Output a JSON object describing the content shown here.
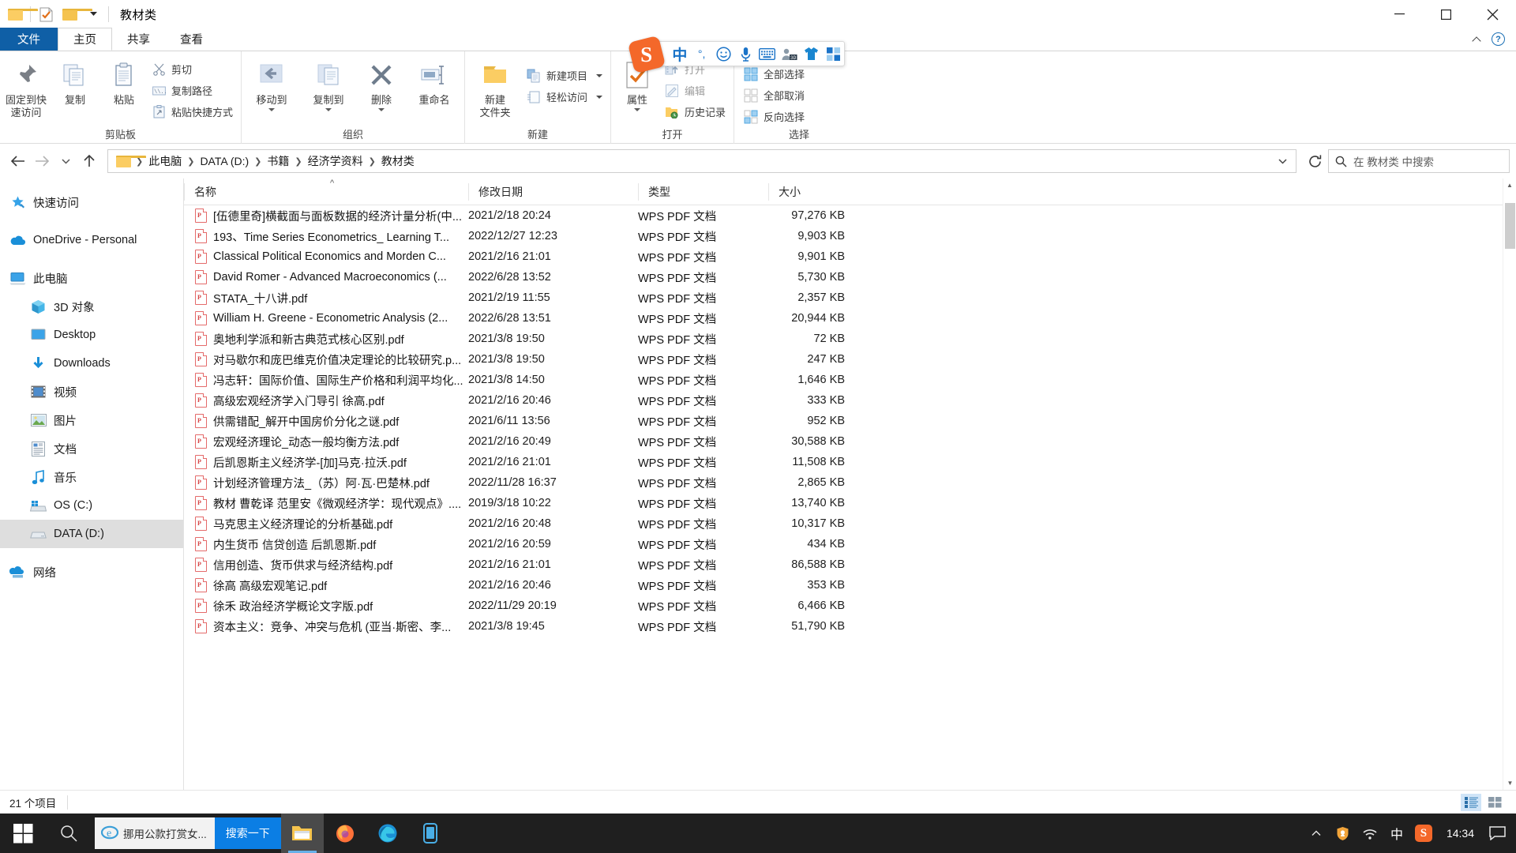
{
  "window": {
    "title": "教材类",
    "quick_access_icons": [
      "folder-icon",
      "properties-check-icon",
      "new-folder-icon",
      "chevron-down-icon"
    ],
    "controls": {
      "minimize": "minimize-icon",
      "maximize": "maximize-icon",
      "close": "close-icon"
    }
  },
  "tabs": [
    {
      "label": "文件",
      "kind": "file"
    },
    {
      "label": "主页",
      "kind": "active"
    },
    {
      "label": "共享",
      "kind": "normal"
    },
    {
      "label": "查看",
      "kind": "normal"
    }
  ],
  "ribbon": {
    "groups": [
      {
        "label": "剪贴板",
        "big": [
          {
            "label": "固定到快\n速访问",
            "icon": "pin-icon"
          },
          {
            "label": "复制",
            "icon": "copy-icon"
          },
          {
            "label": "粘贴",
            "icon": "paste-icon"
          }
        ],
        "small": [
          {
            "label": "剪切",
            "icon": "scissors-icon"
          },
          {
            "label": "复制路径",
            "icon": "copy-path-icon"
          },
          {
            "label": "粘贴快捷方式",
            "icon": "paste-shortcut-icon"
          }
        ]
      },
      {
        "label": "组织",
        "big": [
          {
            "label": "移动到",
            "icon": "move-to-icon",
            "has_caret": true
          },
          {
            "label": "复制到",
            "icon": "copy-to-icon",
            "has_caret": true
          },
          {
            "label": "删除",
            "icon": "delete-x-icon",
            "has_caret": true
          },
          {
            "label": "重命名",
            "icon": "rename-icon"
          }
        ],
        "small": []
      },
      {
        "label": "新建",
        "big": [
          {
            "label": "新建\n文件夹",
            "icon": "new-folder-icon"
          }
        ],
        "small": [
          {
            "label": "新建项目",
            "icon": "new-item-icon",
            "has_caret": true
          },
          {
            "label": "轻松访问",
            "icon": "easy-access-icon",
            "has_caret": true
          }
        ]
      },
      {
        "label": "打开",
        "big": [
          {
            "label": "属性",
            "icon": "properties-check-icon",
            "has_caret": true
          }
        ],
        "small": [
          {
            "label": "打开",
            "icon": "open-icon",
            "disabled": true
          },
          {
            "label": "编辑",
            "icon": "edit-pencil-icon",
            "disabled": true
          },
          {
            "label": "历史记录",
            "icon": "history-folder-icon"
          }
        ]
      },
      {
        "label": "选择",
        "big": [],
        "small": [
          {
            "label": "全部选择",
            "icon": "select-all-icon"
          },
          {
            "label": "全部取消",
            "icon": "select-none-icon"
          },
          {
            "label": "反向选择",
            "icon": "invert-selection-icon"
          }
        ]
      }
    ],
    "collapse_icon": "chevron-up-icon",
    "help_icon": "help-question-icon"
  },
  "ime_toolbar": {
    "logo_letter": "S",
    "icons": [
      "chinese-mode-icon",
      "punctuation-icon",
      "emoji-icon",
      "microphone-icon",
      "keyboard-icon",
      "user-3d-icon",
      "skin-shirt-icon",
      "toolbox-icon"
    ],
    "mode_label": "中",
    "punct_label": "°,"
  },
  "address": {
    "back_icon": "back-arrow-icon",
    "forward_icon": "forward-arrow-icon",
    "recent_icon": "chevron-down-icon",
    "up_icon": "up-arrow-icon",
    "folder_icon": "folder-icon",
    "crumbs": [
      "此电脑",
      "DATA (D:)",
      "书籍",
      "经济学资料",
      "教材类"
    ],
    "dropdown_icon": "chevron-down-icon",
    "refresh_icon": "refresh-icon",
    "search_icon": "search-icon",
    "search_placeholder": "在 教材类 中搜索"
  },
  "nav_pane": {
    "items": [
      {
        "label": "快速访问",
        "icon": "pin-star-icon",
        "indent": false,
        "gap_after": true
      },
      {
        "label": "OneDrive - Personal",
        "icon": "onedrive-cloud-icon",
        "indent": false,
        "gap_after": true
      },
      {
        "label": "此电脑",
        "icon": "this-pc-icon",
        "indent": false
      },
      {
        "label": "3D 对象",
        "icon": "3d-objects-icon",
        "indent": true
      },
      {
        "label": "Desktop",
        "icon": "desktop-icon",
        "indent": true
      },
      {
        "label": "Downloads",
        "icon": "downloads-arrow-icon",
        "indent": true
      },
      {
        "label": "视频",
        "icon": "videos-icon",
        "indent": true
      },
      {
        "label": "图片",
        "icon": "pictures-icon",
        "indent": true
      },
      {
        "label": "文档",
        "icon": "documents-icon",
        "indent": true
      },
      {
        "label": "音乐",
        "icon": "music-note-icon",
        "indent": true
      },
      {
        "label": "OS (C:)",
        "icon": "windows-drive-icon",
        "indent": true
      },
      {
        "label": "DATA (D:)",
        "icon": "hard-drive-icon",
        "indent": true,
        "selected": true,
        "gap_after": true
      },
      {
        "label": "网络",
        "icon": "network-icon",
        "indent": false
      }
    ]
  },
  "file_list": {
    "columns": [
      "名称",
      "修改日期",
      "类型",
      "大小"
    ],
    "sort_indicator": "ascending",
    "rows": [
      {
        "name": "[伍德里奇]横截面与面板数据的经济计量分析(中...",
        "date": "2021/2/18 20:24",
        "type": "WPS PDF 文档",
        "size": "97,276 KB"
      },
      {
        "name": "193、Time Series Econometrics_ Learning T...",
        "date": "2022/12/27 12:23",
        "type": "WPS PDF 文档",
        "size": "9,903 KB"
      },
      {
        "name": "Classical Political Economics and Morden C...",
        "date": "2021/2/16 21:01",
        "type": "WPS PDF 文档",
        "size": "9,901 KB"
      },
      {
        "name": "David Romer - Advanced Macroeconomics (...",
        "date": "2022/6/28 13:52",
        "type": "WPS PDF 文档",
        "size": "5,730 KB"
      },
      {
        "name": "STATA_十八讲.pdf",
        "date": "2021/2/19 11:55",
        "type": "WPS PDF 文档",
        "size": "2,357 KB"
      },
      {
        "name": "William H. Greene - Econometric Analysis (2...",
        "date": "2022/6/28 13:51",
        "type": "WPS PDF 文档",
        "size": "20,944 KB"
      },
      {
        "name": "奥地利学派和新古典范式核心区别.pdf",
        "date": "2021/3/8 19:50",
        "type": "WPS PDF 文档",
        "size": "72 KB"
      },
      {
        "name": "对马歇尔和庞巴维克价值决定理论的比较研究.p...",
        "date": "2021/3/8 19:50",
        "type": "WPS PDF 文档",
        "size": "247 KB"
      },
      {
        "name": "冯志轩：国际价值、国际生产价格和利润平均化...",
        "date": "2021/3/8 14:50",
        "type": "WPS PDF 文档",
        "size": "1,646 KB"
      },
      {
        "name": "高级宏观经济学入门导引 徐高.pdf",
        "date": "2021/2/16 20:46",
        "type": "WPS PDF 文档",
        "size": "333 KB"
      },
      {
        "name": "供需错配_解开中国房价分化之谜.pdf",
        "date": "2021/6/11 13:56",
        "type": "WPS PDF 文档",
        "size": "952 KB"
      },
      {
        "name": "宏观经济理论_动态一般均衡方法.pdf",
        "date": "2021/2/16 20:49",
        "type": "WPS PDF 文档",
        "size": "30,588 KB"
      },
      {
        "name": "后凯恩斯主义经济学-[加]马克·拉沃.pdf",
        "date": "2021/2/16 21:01",
        "type": "WPS PDF 文档",
        "size": "11,508 KB"
      },
      {
        "name": "计划经济管理方法_（苏）阿·瓦·巴楚林.pdf",
        "date": "2022/11/28 16:37",
        "type": "WPS PDF 文档",
        "size": "2,865 KB"
      },
      {
        "name": "教材 曹乾译 范里安《微观经济学：现代观点》....",
        "date": "2019/3/18 10:22",
        "type": "WPS PDF 文档",
        "size": "13,740 KB"
      },
      {
        "name": "马克思主义经济理论的分析基础.pdf",
        "date": "2021/2/16 20:48",
        "type": "WPS PDF 文档",
        "size": "10,317 KB"
      },
      {
        "name": "内生货币 信贷创造 后凯恩斯.pdf",
        "date": "2021/2/16 20:59",
        "type": "WPS PDF 文档",
        "size": "434 KB"
      },
      {
        "name": "信用创造、货币供求与经济结构.pdf",
        "date": "2021/2/16 21:01",
        "type": "WPS PDF 文档",
        "size": "86,588 KB"
      },
      {
        "name": "徐高 高级宏观笔记.pdf",
        "date": "2021/2/16 20:46",
        "type": "WPS PDF 文档",
        "size": "353 KB"
      },
      {
        "name": "徐禾 政治经济学概论文字版.pdf",
        "date": "2022/11/29 20:19",
        "type": "WPS PDF 文档",
        "size": "6,466 KB"
      },
      {
        "name": "资本主义：竞争、冲突与危机 (亚当·斯密、李...",
        "date": "2021/3/8 19:45",
        "type": "WPS PDF 文档",
        "size": "51,790 KB"
      }
    ]
  },
  "status": {
    "item_count": "21 个项目",
    "view_details_icon": "details-view-icon",
    "view_tiles_icon": "tiles-view-icon"
  },
  "taskbar": {
    "start_icon": "windows-start-icon",
    "search_icon": "search-icon",
    "ie_text": "挪用公款打赏女...",
    "ie_search_button": "搜索一下",
    "apps": [
      "file-explorer-icon",
      "firefox-icon",
      "edge-icon",
      "phone-link-icon"
    ],
    "tray": {
      "show_hidden_icon": "chevron-up-icon",
      "icons": [
        "safety-icon",
        "network-wifi-icon"
      ],
      "ime_label": "中",
      "ime_logo_letter": "S",
      "clock": "14:34",
      "notification_icon": "action-center-icon"
    }
  },
  "colors": {
    "accent_blue": "#0f5fa6",
    "selection_gray": "#dedede",
    "taskbar_bg": "#1f1f1f",
    "ime_orange": "#f4682a",
    "pdf_red": "#d64545",
    "folder_yellow": "#fbcd63"
  }
}
